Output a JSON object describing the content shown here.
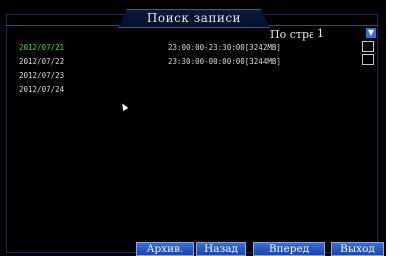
{
  "title": "Поиск записи",
  "page_label": "По  стран.",
  "page_value": "1",
  "dropdown_icon": "chevron-down-icon",
  "dates": [
    "2012/07/21",
    "2012/07/22",
    "2012/07/23",
    "2012/07/24"
  ],
  "records": [
    "23:00:00-23:30:00[3242MB]",
    "23:30:00-00:00:00[3244MB]"
  ],
  "buttons": {
    "archive": "Архив.",
    "back": "Назад",
    "forward": "Вперед",
    "exit": "Выход"
  },
  "colors": {
    "accent_date": "#3fd84a",
    "button": "#2c5fc8",
    "background": "#000000"
  }
}
